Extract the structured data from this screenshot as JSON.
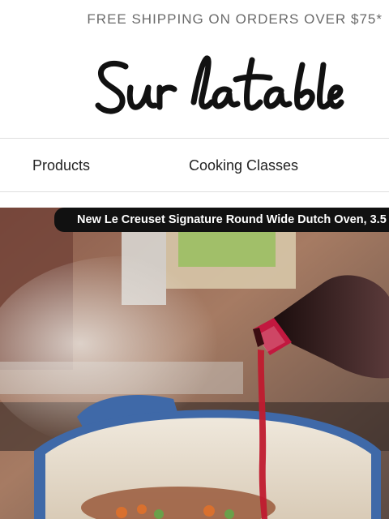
{
  "promo": {
    "text": "FREE SHIPPING ON ORDERS OVER $75*"
  },
  "brand": {
    "logo_text": "Sur la table"
  },
  "nav": {
    "items": [
      {
        "label": "Products"
      },
      {
        "label": "Cooking Classes"
      }
    ]
  },
  "hero": {
    "caption": "New Le Creuset Signature Round Wide Dutch Oven, 3.5"
  }
}
